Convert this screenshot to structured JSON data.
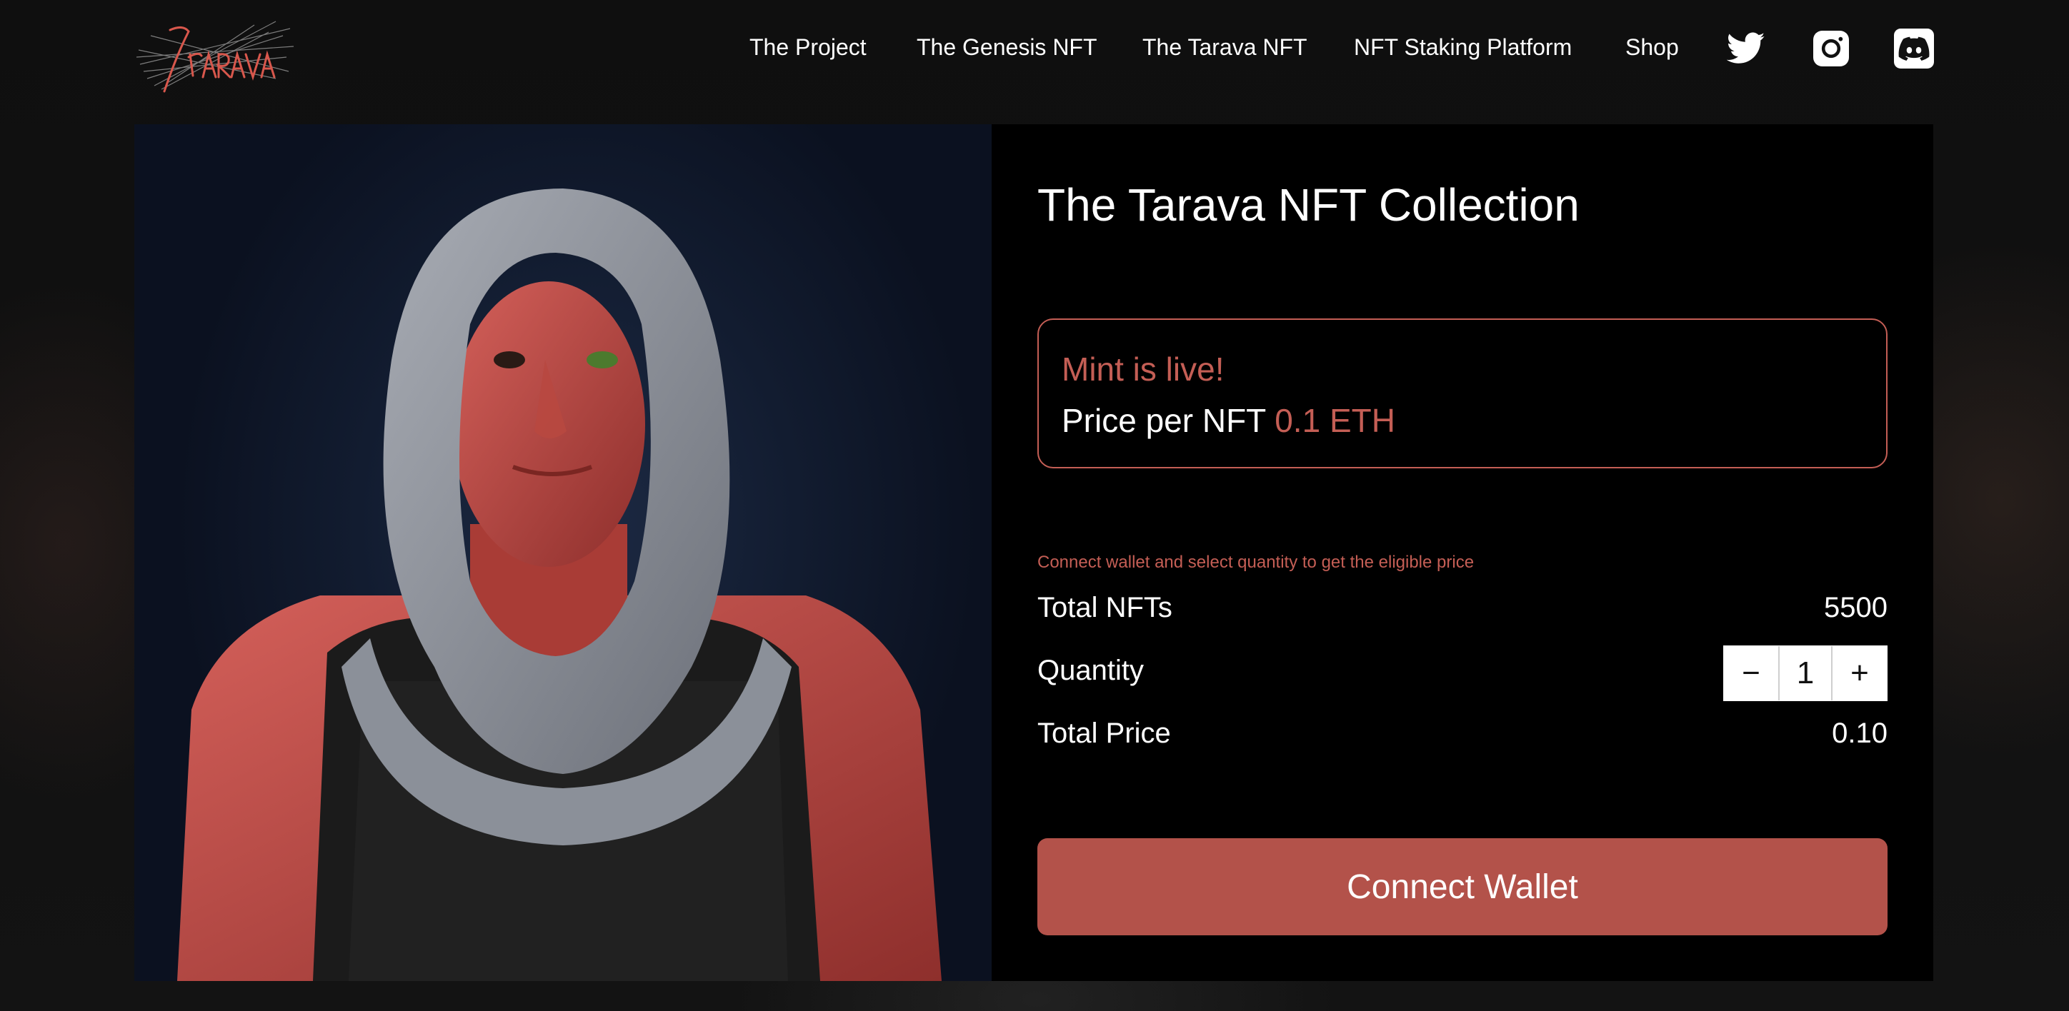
{
  "header": {
    "logo_text": "Tarava",
    "nav": [
      {
        "label": "The Project"
      },
      {
        "label": "The Genesis NFT"
      },
      {
        "label": "The Tarava NFT"
      },
      {
        "label": "NFT Staking Platform"
      },
      {
        "label": "Shop"
      }
    ],
    "social": [
      "twitter-icon",
      "instagram-icon",
      "discord-icon"
    ]
  },
  "collection": {
    "title": "The Tarava NFT Collection",
    "mint_status": "Mint is live!",
    "price_label": "Price per NFT",
    "price_value": "0.1 ETH",
    "hint": "Connect wallet and select quantity to get the eligible price",
    "total_nfts_label": "Total NFTs",
    "total_nfts_value": "5500",
    "quantity_label": "Quantity",
    "quantity_value": "1",
    "decrement_symbol": "−",
    "increment_symbol": "+",
    "total_price_label": "Total Price",
    "total_price_value": "0.10",
    "connect_label": "Connect Wallet"
  },
  "colors": {
    "accent": "#c45e55",
    "button": "#b3524a",
    "background": "#000000"
  }
}
